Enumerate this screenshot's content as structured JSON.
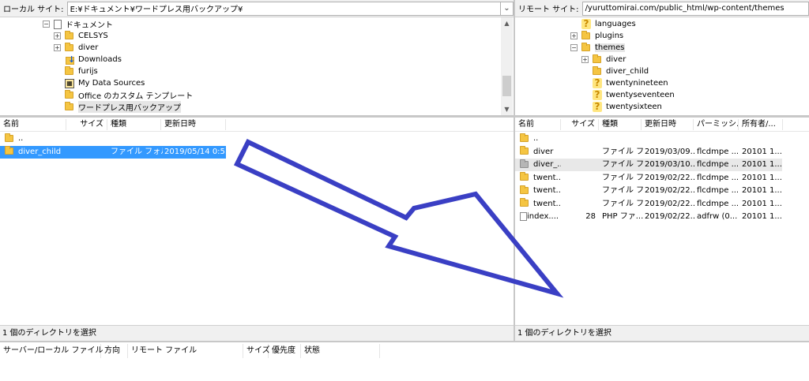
{
  "local": {
    "site_label": "ローカル サイト:",
    "path": "E:¥ドキュメント¥ワードプレス用バックアップ¥",
    "tree": [
      {
        "label": "ドキュメント",
        "icon": "document-icon",
        "expander": "minus"
      },
      {
        "label": "CELSYS",
        "icon": "folder-icon",
        "expander": "plus"
      },
      {
        "label": "diver",
        "icon": "folder-icon",
        "expander": "plus"
      },
      {
        "label": "Downloads",
        "icon": "downloads-folder-icon",
        "expander": "none"
      },
      {
        "label": "furijs",
        "icon": "folder-icon",
        "expander": "none"
      },
      {
        "label": "My Data Sources",
        "icon": "data-sources-icon",
        "expander": "none"
      },
      {
        "label": "Office のカスタム テンプレート",
        "icon": "folder-icon",
        "expander": "none"
      },
      {
        "label": "ワードプレス用バックアップ",
        "icon": "folder-icon",
        "expander": "none",
        "selected": true
      }
    ],
    "columns": [
      "名前",
      "サイズ",
      "種類",
      "更新日時"
    ],
    "rows": [
      {
        "name": "..",
        "size": "",
        "type": "",
        "modified": "",
        "icon": "folder-icon"
      },
      {
        "name": "diver_child",
        "size": "",
        "type": "ファイル フォル...",
        "modified": "2019/05/14 0:5...",
        "icon": "folder-icon",
        "selected": true
      }
    ],
    "status": "1 個のディレクトリを選択"
  },
  "remote": {
    "site_label": "リモート サイト:",
    "path": "/yuruttomirai.com/public_html/wp-content/themes",
    "tree": [
      {
        "label": "languages",
        "icon": "unknown-folder-icon",
        "expander": "none"
      },
      {
        "label": "plugins",
        "icon": "folder-icon",
        "expander": "plus"
      },
      {
        "label": "themes",
        "icon": "folder-icon",
        "expander": "minus",
        "selected": true
      },
      {
        "label": "diver",
        "icon": "folder-icon",
        "expander": "plus"
      },
      {
        "label": "diver_child",
        "icon": "folder-icon",
        "expander": "none"
      },
      {
        "label": "twentynineteen",
        "icon": "unknown-folder-icon",
        "expander": "none"
      },
      {
        "label": "twentyseventeen",
        "icon": "unknown-folder-icon",
        "expander": "none"
      },
      {
        "label": "twentysixteen",
        "icon": "unknown-folder-icon",
        "expander": "none"
      }
    ],
    "columns": [
      "名前",
      "サイズ",
      "種類",
      "更新日時",
      "パーミッシ...",
      "所有者/..."
    ],
    "rows": [
      {
        "name": "..",
        "size": "",
        "type": "",
        "modified": "",
        "perm": "",
        "owner": "",
        "icon": "folder-icon"
      },
      {
        "name": "diver",
        "size": "",
        "type": "ファイル フ...",
        "modified": "2019/03/09...",
        "perm": "flcdmpe ...",
        "owner": "20101 1...",
        "icon": "folder-icon"
      },
      {
        "name": "diver_...",
        "size": "",
        "type": "ファイル フ...",
        "modified": "2019/03/10...",
        "perm": "flcdmpe ...",
        "owner": "20101 1...",
        "icon": "grey-folder-icon",
        "highlighted": true
      },
      {
        "name": "twent...",
        "size": "",
        "type": "ファイル フ...",
        "modified": "2019/02/22...",
        "perm": "flcdmpe ...",
        "owner": "20101 1...",
        "icon": "folder-icon"
      },
      {
        "name": "twent...",
        "size": "",
        "type": "ファイル フ...",
        "modified": "2019/02/22...",
        "perm": "flcdmpe ...",
        "owner": "20101 1...",
        "icon": "folder-icon"
      },
      {
        "name": "twent...",
        "size": "",
        "type": "ファイル フ...",
        "modified": "2019/02/22...",
        "perm": "flcdmpe ...",
        "owner": "20101 1...",
        "icon": "folder-icon"
      },
      {
        "name": "index....",
        "size": "28",
        "type": "PHP ファ...",
        "modified": "2019/02/22...",
        "perm": "adfrw (0...",
        "owner": "20101 1...",
        "icon": "file-icon"
      }
    ],
    "status": "1 個のディレクトリを選択"
  },
  "queue": {
    "columns": [
      "サーバー/ローカル ファイル",
      "方向",
      "リモート ファイル",
      "サイズ",
      "優先度",
      "状態"
    ]
  },
  "annotation": {
    "arrow_color": "#3a3fc4"
  }
}
